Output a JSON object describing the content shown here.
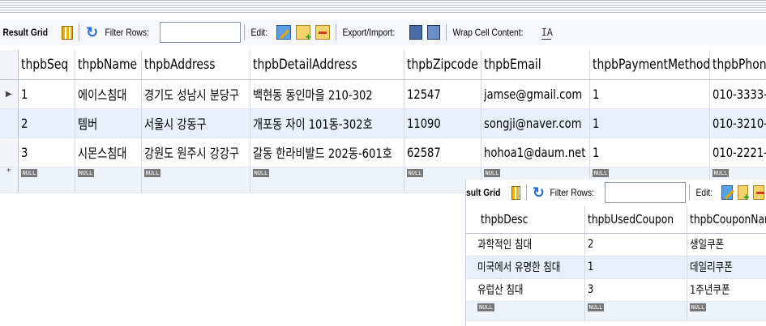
{
  "toolbar": {
    "result_grid": "Result Grid",
    "filter_rows": "Filter Rows:",
    "filter_value": "",
    "edit": "Edit:",
    "export_import": "Export/Import:",
    "wrap_cell": "Wrap Cell Content:",
    "wrap_icon_glyph": "IA"
  },
  "grid1": {
    "columns": [
      "thpbSeq",
      "thpbName",
      "thpbAddress",
      "thpbDetailAddress",
      "thpbZipcode",
      "thpbEmail",
      "thpbPaymentMethod",
      "thpbPhone"
    ],
    "rows": [
      [
        "1",
        "에이스침대",
        "경기도 성남시 분당구",
        "백현동 동인마을 210-302",
        "12547",
        "jamse@gmail.com",
        "1",
        "010-3333-"
      ],
      [
        "2",
        "템버",
        "서울시 강동구",
        "개포동 자이 101동-302호",
        "11090",
        "songji@naver.com",
        "1",
        "010-3210-"
      ],
      [
        "3",
        "시몬스침대",
        "강원도 원주시 강강구",
        "갈동 한라비발드 202동-601호",
        "62587",
        "hohoa1@daum.net",
        "1",
        "010-2221-"
      ]
    ],
    "null_label": "NULL",
    "current_row_marker": "▶",
    "new_row_marker": "*"
  },
  "overlay": {
    "toolbar": {
      "result_grid": "sult Grid",
      "filter_rows": "Filter Rows:",
      "filter_value": "",
      "edit": "Edit:"
    },
    "columns": [
      "thpbDesc",
      "thpbUsedCoupon",
      "thpbCouponName"
    ],
    "rows": [
      [
        "과학적인 침대",
        "2",
        "생일쿠폰"
      ],
      [
        "미국에서 유명한 침대",
        "1",
        "데일리쿠폰"
      ],
      [
        "유럽산 침대",
        "3",
        "1주년쿠폰"
      ]
    ],
    "null_label": "NULL"
  },
  "colors": {
    "alt_row": "#e9f0fb",
    "null_badge": "#787878",
    "toolbar_bg": "#f7f8fb"
  }
}
